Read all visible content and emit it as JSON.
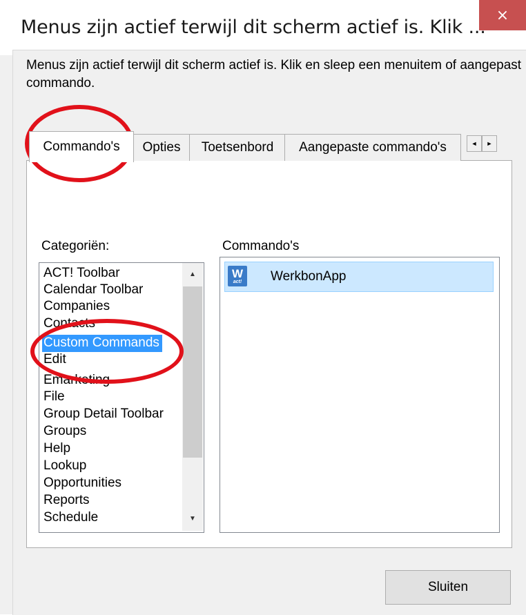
{
  "window": {
    "title": "Menus zijn actief terwijl dit scherm actief is. Klik ...",
    "close_glyph": "×"
  },
  "instructions": "Menus zijn actief terwijl dit scherm actief is. Klik en sleep een menuitem of aangepast commando.",
  "tabs": [
    {
      "label": "Commando's",
      "active": true
    },
    {
      "label": "Opties",
      "active": false
    },
    {
      "label": "Toetsenbord",
      "active": false
    },
    {
      "label": "Aangepaste commando's",
      "active": false
    }
  ],
  "tab_scroll": {
    "left": "◄",
    "right": "►"
  },
  "categories": {
    "label": "Categoriën:",
    "items": [
      "ACT! Toolbar",
      "Calendar Toolbar",
      "Companies",
      "Contacts",
      "Custom Commands",
      "Edit",
      "Emarketing",
      "File",
      "Group Detail Toolbar",
      "Groups",
      "Help",
      "Lookup",
      "Opportunities",
      "Reports",
      "Schedule"
    ],
    "selected": "Custom Commands",
    "scroll_up": "▲",
    "scroll_down": "▼"
  },
  "commands": {
    "label": "Commando's",
    "items": [
      {
        "label": "WerkbonApp",
        "icon": "werkbonapp-icon",
        "icon_text_main": "W",
        "icon_text_sub": "act!"
      }
    ]
  },
  "buttons": {
    "close": "Sluiten"
  },
  "annotation_color": "#e1111a"
}
